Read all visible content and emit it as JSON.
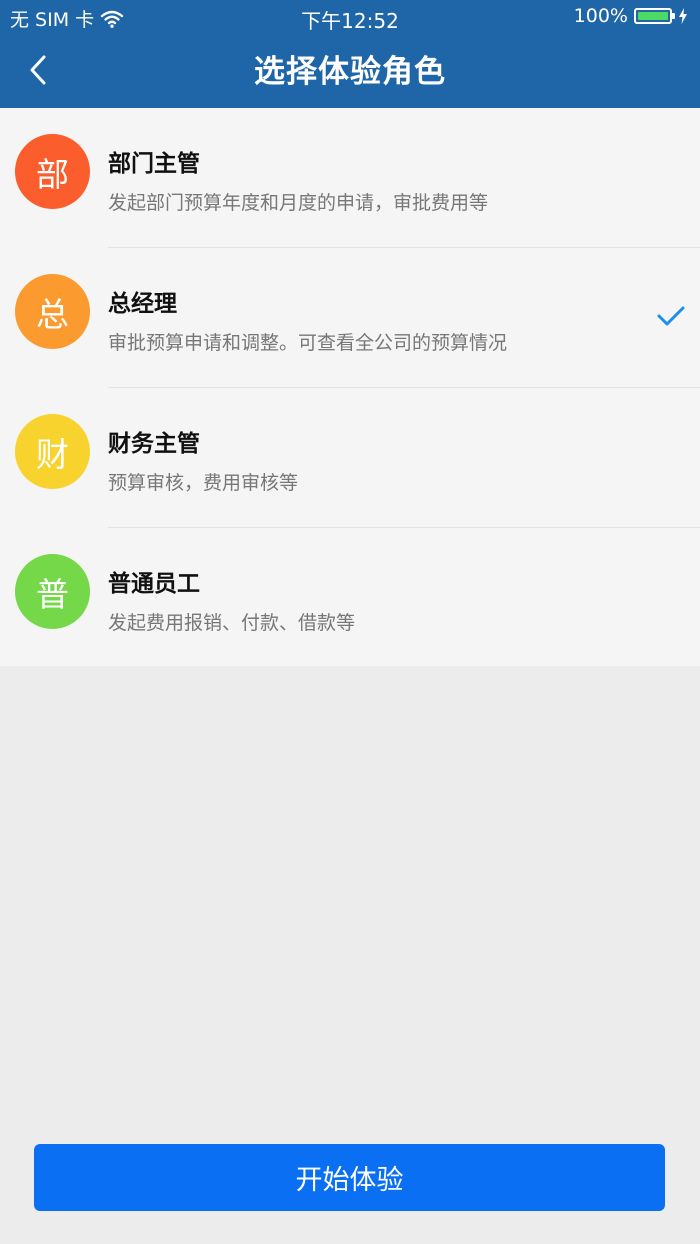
{
  "status_bar": {
    "carrier": "无 SIM 卡",
    "time": "下午12:52",
    "battery": "100%",
    "icons": [
      "wifi-icon",
      "battery-icon",
      "charging-bolt-icon"
    ]
  },
  "header": {
    "title": "选择体验角色",
    "back_icon": "chevron-left-icon"
  },
  "roles": [
    {
      "avatar": "部",
      "avatar_color": "#fc5d2c",
      "title": "部门主管",
      "description": "发起部门预算年度和月度的申请，审批费用等",
      "selected": false
    },
    {
      "avatar": "总",
      "avatar_color": "#fb9b2f",
      "title": "总经理",
      "description": "审批预算申请和调整。可查看全公司的预算情况",
      "selected": true
    },
    {
      "avatar": "财",
      "avatar_color": "#f8d32e",
      "title": "财务主管",
      "description": "预算审核，费用审核等",
      "selected": false
    },
    {
      "avatar": "普",
      "avatar_color": "#75d848",
      "title": "普通员工",
      "description": "发起费用报销、付款、借款等",
      "selected": false
    }
  ],
  "selection_icon": "checkmark-icon",
  "start_button": {
    "label": "开始体验",
    "color": "#0a6ff2"
  },
  "colors": {
    "header_bg": "#1f66a8",
    "accent": "#1a8ff0"
  }
}
